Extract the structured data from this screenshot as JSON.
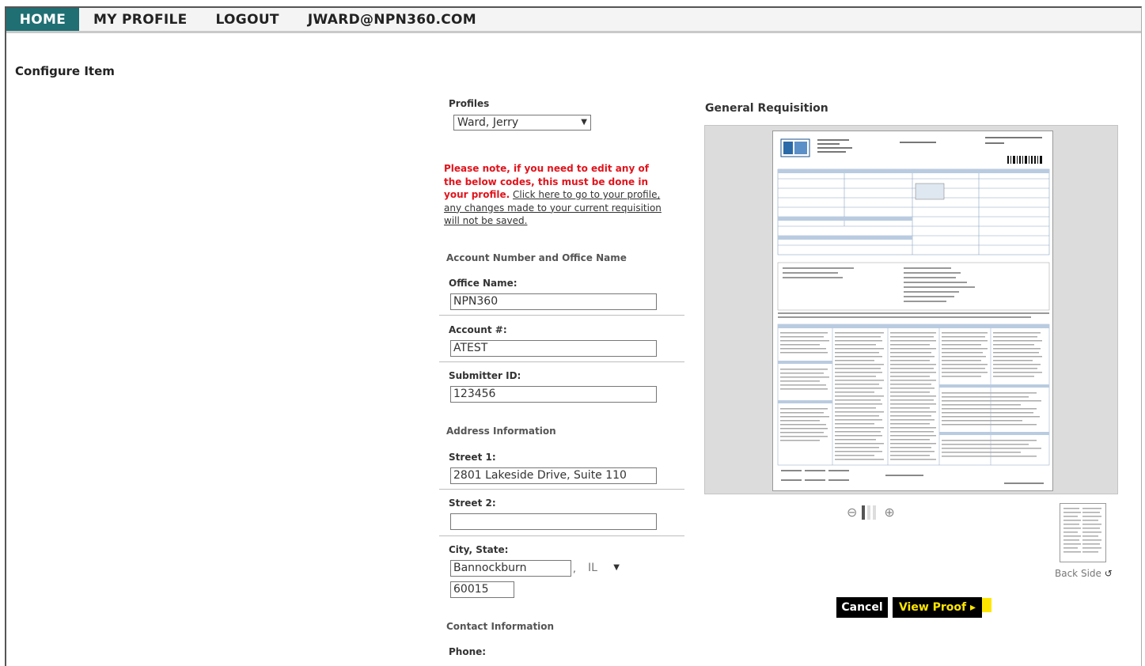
{
  "nav": {
    "home": "HOME",
    "profile": "MY PROFILE",
    "logout": "LOGOUT",
    "email": "JWARD@NPN360.COM"
  },
  "page": {
    "title": "Configure Item"
  },
  "profiles": {
    "label": "Profiles",
    "selected": "Ward, Jerry"
  },
  "note": {
    "red": "Please note, if you need to edit any of the below codes, this must be done in your profile.",
    "link": "Click here to go to your profile, any changes made to your current requisition will not be saved."
  },
  "account_section": {
    "title": "Account Number and Office Name"
  },
  "fields": {
    "office_name": {
      "label": "Office Name:",
      "value": "NPN360"
    },
    "account": {
      "label": "Account #:",
      "value": "ATEST"
    },
    "submitter": {
      "label": "Submitter ID:",
      "value": "123456"
    },
    "street1": {
      "label": "Street 1:",
      "value": "2801 Lakeside Drive, Suite 110"
    },
    "street2": {
      "label": "Street 2:",
      "value": ""
    },
    "city_state": {
      "label": "City, State:",
      "city": "Bannockburn",
      "state": "IL",
      "zip": "60015"
    },
    "phone": {
      "label": "Phone:"
    }
  },
  "address_section": {
    "title": "Address Information"
  },
  "contact_section": {
    "title": "Contact Information"
  },
  "preview": {
    "title": "General Requisition",
    "back_side": "Back Side",
    "zoom_level": 0.3
  },
  "buttons": {
    "cancel": "Cancel",
    "view_proof": "View Proof ▸"
  },
  "colors": {
    "nav_active": "#1f6f73",
    "note_red": "#e0141c",
    "proof_yellow": "#ffe600"
  }
}
